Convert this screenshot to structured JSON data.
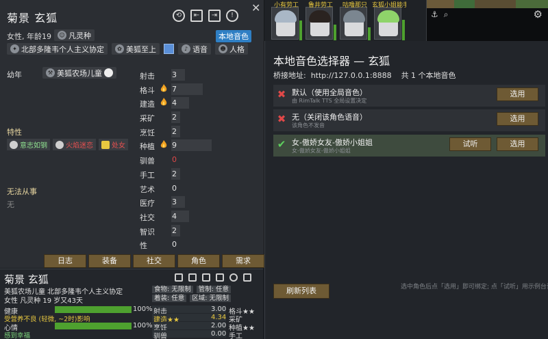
{
  "card": {
    "name": "菊景 玄狐",
    "subtitle": "女性, 年龄19",
    "xenotype": "凡灵种",
    "voice_button": "本地音色",
    "faction": "北部多隆韦个人主义协定",
    "ideo": "美狐至上",
    "voice_chip": "语音",
    "persona_chip": "人格",
    "childhood_label": "幼年",
    "backstory": "美狐农场儿童",
    "traits_header": "特性",
    "traits": [
      {
        "label": "意志如钢",
        "tone": "green"
      },
      {
        "label": "火焰迷恋",
        "tone": "red"
      },
      {
        "label": "处女",
        "tone": "red"
      }
    ],
    "incapable_header": "无法从事",
    "incapable_value": "无",
    "skills": [
      {
        "label": "射击",
        "value": "3",
        "passion": 0,
        "level": 3
      },
      {
        "label": "格斗",
        "value": "7",
        "passion": 1,
        "level": 7
      },
      {
        "label": "建造",
        "value": "4",
        "passion": 1,
        "level": 4
      },
      {
        "label": "采矿",
        "value": "2",
        "passion": 0,
        "level": 2
      },
      {
        "label": "烹饪",
        "value": "2",
        "passion": 0,
        "level": 2
      },
      {
        "label": "种植",
        "value": "9",
        "passion": 1,
        "level": 9
      },
      {
        "label": "驯兽",
        "value": "0",
        "passion": 0,
        "level": 0
      },
      {
        "label": "手工",
        "value": "2",
        "passion": 0,
        "level": 2
      },
      {
        "label": "艺术",
        "value": "0",
        "passion": 0,
        "level": 0
      },
      {
        "label": "医疗",
        "value": "3",
        "passion": 0,
        "level": 3
      },
      {
        "label": "社交",
        "value": "4",
        "passion": 0,
        "level": 4
      },
      {
        "label": "智识",
        "value": "2",
        "passion": 0,
        "level": 2
      },
      {
        "label": "性",
        "value": "0",
        "passion": 0,
        "level": 0
      }
    ],
    "tabs": [
      "日志",
      "装备",
      "社交",
      "角色",
      "需求"
    ]
  },
  "inspect": {
    "name": "菊景 玄狐",
    "line1": "美狐农场儿童 北部多隆韦个人主义协定",
    "line2": "女性 凡灵种 19 岁又43天",
    "policies": [
      [
        "食物: 无限制",
        "管制: 任意"
      ],
      [
        "着装: 任意",
        "区域: 无限制"
      ]
    ],
    "needs": [
      {
        "label": "健康",
        "pct": "100%",
        "level": 1.0
      },
      {
        "label": "受营养不良 (轻微, ~2时)影响",
        "pct": "",
        "level": 0,
        "tone": "warn"
      },
      {
        "label": "心情",
        "pct": "100%",
        "level": 1.0
      },
      {
        "label": "感到幸福",
        "pct": "",
        "level": 0,
        "tone": "good"
      }
    ],
    "skills": [
      {
        "a": "射击",
        "v": "3.00",
        "b": "格斗★★",
        "gold": false
      },
      {
        "a": "建造★★",
        "v": "4.34",
        "b": "采矿",
        "gold": true
      },
      {
        "a": "烹饪",
        "v": "2.00",
        "b": "种植★★",
        "gold": false
      },
      {
        "a": "驯兽",
        "v": "0.00",
        "b": "手工",
        "gold": false
      }
    ]
  },
  "colonists": [
    {
      "label": "小有劳工",
      "hair": "#a9b7c6",
      "mood": 0.75
    },
    {
      "label": "鲁井劳工",
      "hair": "#2a2320",
      "mood": 0.6
    },
    {
      "label": "咕噜那只",
      "hair": "#7b8690",
      "mood": 0.5
    },
    {
      "label": "玄狐小姐能手",
      "hair": "#8fd46a",
      "mood": 0.8
    }
  ],
  "minimap": {
    "icons": [
      "anchor-icon",
      "search-icon"
    ],
    "gear": "gear-icon"
  },
  "voice": {
    "title": "本地音色选择器 — 玄狐",
    "bridge": "桥接地址:  http://127.0.0.1:8888    共 1 个本地音色",
    "options": [
      {
        "title": "默认（使用全局音色）",
        "subtitle": "由 RimTalk TTS 全局设置决定",
        "mark": "x",
        "selected": false,
        "buttons": [
          "选用"
        ]
      },
      {
        "title": "无（关闭该角色语音）",
        "subtitle": "该角色不发音",
        "mark": "x",
        "selected": false,
        "buttons": [
          "选用"
        ]
      },
      {
        "title": "女-傲娇女友-傲娇小姐姐",
        "subtitle": "女-傲娇女友-傲娇小姐姐",
        "mark": "ok",
        "selected": true,
        "buttons": [
          "试听",
          "选用"
        ]
      }
    ],
    "refresh": "刷新列表",
    "hint": "选中角色后点「选用」即可绑定; 点「试听」用示例台词实时合成并播放。"
  }
}
